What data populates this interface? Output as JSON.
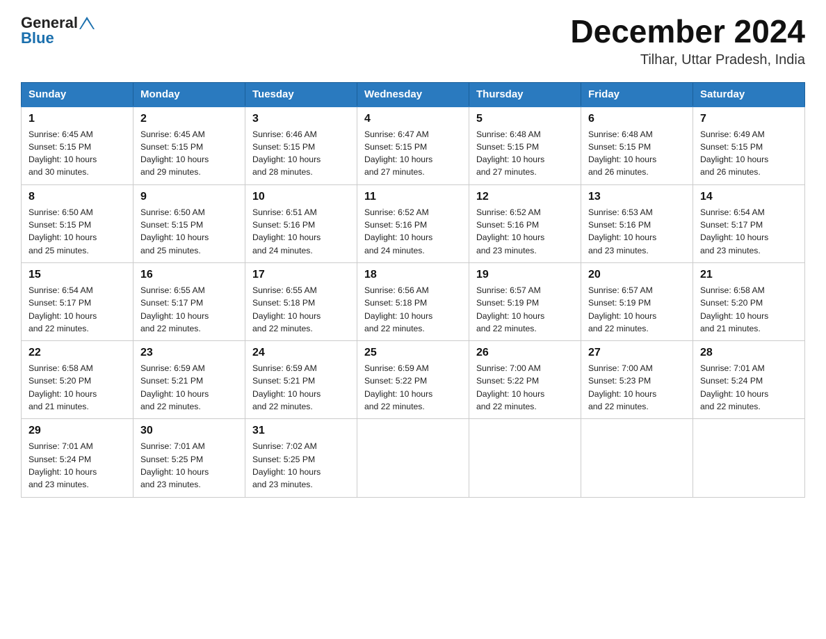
{
  "header": {
    "logo_general": "General",
    "logo_blue": "Blue",
    "month_title": "December 2024",
    "subtitle": "Tilhar, Uttar Pradesh, India"
  },
  "days_of_week": [
    "Sunday",
    "Monday",
    "Tuesday",
    "Wednesday",
    "Thursday",
    "Friday",
    "Saturday"
  ],
  "weeks": [
    [
      {
        "day": "1",
        "sunrise": "6:45 AM",
        "sunset": "5:15 PM",
        "daylight": "10 hours and 30 minutes."
      },
      {
        "day": "2",
        "sunrise": "6:45 AM",
        "sunset": "5:15 PM",
        "daylight": "10 hours and 29 minutes."
      },
      {
        "day": "3",
        "sunrise": "6:46 AM",
        "sunset": "5:15 PM",
        "daylight": "10 hours and 28 minutes."
      },
      {
        "day": "4",
        "sunrise": "6:47 AM",
        "sunset": "5:15 PM",
        "daylight": "10 hours and 27 minutes."
      },
      {
        "day": "5",
        "sunrise": "6:48 AM",
        "sunset": "5:15 PM",
        "daylight": "10 hours and 27 minutes."
      },
      {
        "day": "6",
        "sunrise": "6:48 AM",
        "sunset": "5:15 PM",
        "daylight": "10 hours and 26 minutes."
      },
      {
        "day": "7",
        "sunrise": "6:49 AM",
        "sunset": "5:15 PM",
        "daylight": "10 hours and 26 minutes."
      }
    ],
    [
      {
        "day": "8",
        "sunrise": "6:50 AM",
        "sunset": "5:15 PM",
        "daylight": "10 hours and 25 minutes."
      },
      {
        "day": "9",
        "sunrise": "6:50 AM",
        "sunset": "5:15 PM",
        "daylight": "10 hours and 25 minutes."
      },
      {
        "day": "10",
        "sunrise": "6:51 AM",
        "sunset": "5:16 PM",
        "daylight": "10 hours and 24 minutes."
      },
      {
        "day": "11",
        "sunrise": "6:52 AM",
        "sunset": "5:16 PM",
        "daylight": "10 hours and 24 minutes."
      },
      {
        "day": "12",
        "sunrise": "6:52 AM",
        "sunset": "5:16 PM",
        "daylight": "10 hours and 23 minutes."
      },
      {
        "day": "13",
        "sunrise": "6:53 AM",
        "sunset": "5:16 PM",
        "daylight": "10 hours and 23 minutes."
      },
      {
        "day": "14",
        "sunrise": "6:54 AM",
        "sunset": "5:17 PM",
        "daylight": "10 hours and 23 minutes."
      }
    ],
    [
      {
        "day": "15",
        "sunrise": "6:54 AM",
        "sunset": "5:17 PM",
        "daylight": "10 hours and 22 minutes."
      },
      {
        "day": "16",
        "sunrise": "6:55 AM",
        "sunset": "5:17 PM",
        "daylight": "10 hours and 22 minutes."
      },
      {
        "day": "17",
        "sunrise": "6:55 AM",
        "sunset": "5:18 PM",
        "daylight": "10 hours and 22 minutes."
      },
      {
        "day": "18",
        "sunrise": "6:56 AM",
        "sunset": "5:18 PM",
        "daylight": "10 hours and 22 minutes."
      },
      {
        "day": "19",
        "sunrise": "6:57 AM",
        "sunset": "5:19 PM",
        "daylight": "10 hours and 22 minutes."
      },
      {
        "day": "20",
        "sunrise": "6:57 AM",
        "sunset": "5:19 PM",
        "daylight": "10 hours and 22 minutes."
      },
      {
        "day": "21",
        "sunrise": "6:58 AM",
        "sunset": "5:20 PM",
        "daylight": "10 hours and 21 minutes."
      }
    ],
    [
      {
        "day": "22",
        "sunrise": "6:58 AM",
        "sunset": "5:20 PM",
        "daylight": "10 hours and 21 minutes."
      },
      {
        "day": "23",
        "sunrise": "6:59 AM",
        "sunset": "5:21 PM",
        "daylight": "10 hours and 22 minutes."
      },
      {
        "day": "24",
        "sunrise": "6:59 AM",
        "sunset": "5:21 PM",
        "daylight": "10 hours and 22 minutes."
      },
      {
        "day": "25",
        "sunrise": "6:59 AM",
        "sunset": "5:22 PM",
        "daylight": "10 hours and 22 minutes."
      },
      {
        "day": "26",
        "sunrise": "7:00 AM",
        "sunset": "5:22 PM",
        "daylight": "10 hours and 22 minutes."
      },
      {
        "day": "27",
        "sunrise": "7:00 AM",
        "sunset": "5:23 PM",
        "daylight": "10 hours and 22 minutes."
      },
      {
        "day": "28",
        "sunrise": "7:01 AM",
        "sunset": "5:24 PM",
        "daylight": "10 hours and 22 minutes."
      }
    ],
    [
      {
        "day": "29",
        "sunrise": "7:01 AM",
        "sunset": "5:24 PM",
        "daylight": "10 hours and 23 minutes."
      },
      {
        "day": "30",
        "sunrise": "7:01 AM",
        "sunset": "5:25 PM",
        "daylight": "10 hours and 23 minutes."
      },
      {
        "day": "31",
        "sunrise": "7:02 AM",
        "sunset": "5:25 PM",
        "daylight": "10 hours and 23 minutes."
      },
      null,
      null,
      null,
      null
    ]
  ],
  "labels": {
    "sunrise": "Sunrise:",
    "sunset": "Sunset:",
    "daylight": "Daylight:"
  }
}
